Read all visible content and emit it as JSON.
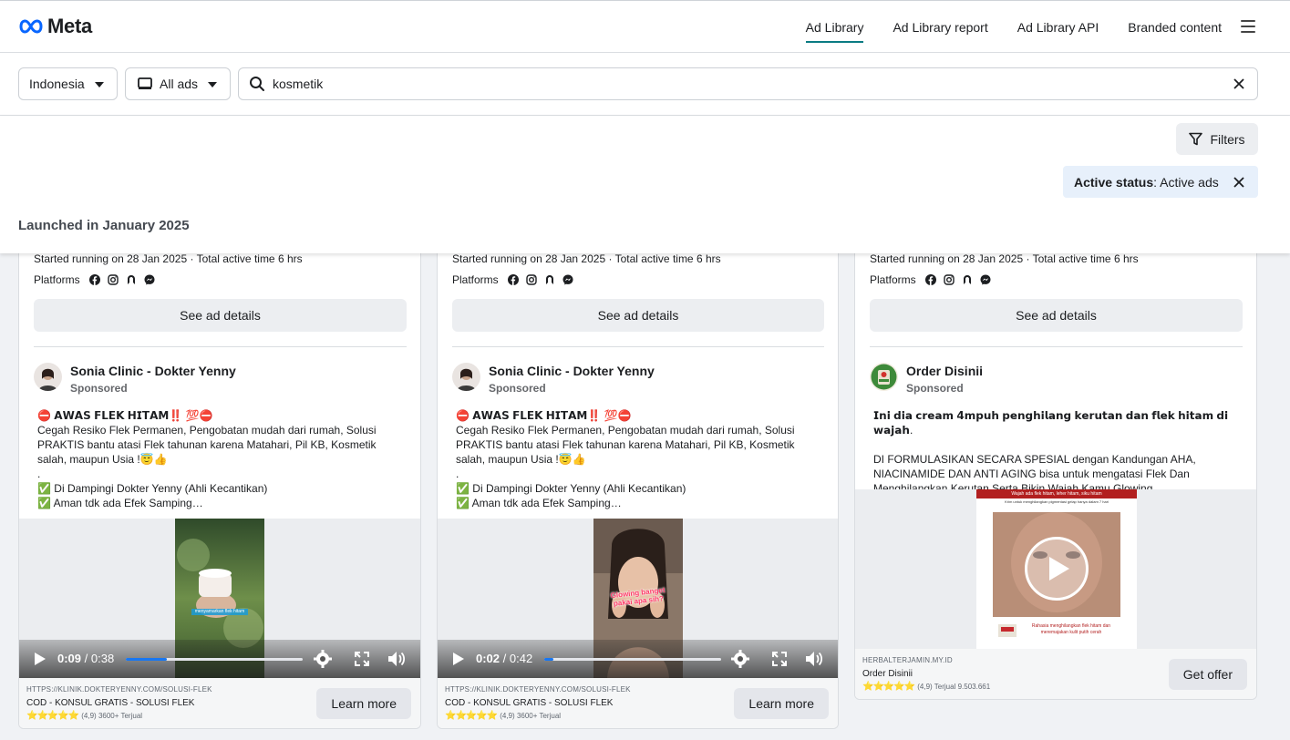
{
  "nav": {
    "logo": "Meta",
    "links": [
      "Ad Library",
      "Ad Library report",
      "Ad Library API",
      "Branded content"
    ],
    "menu_icon": "hamburger-icon"
  },
  "search": {
    "country": "Indonesia",
    "ad_type": "All ads",
    "query": "kosmetik"
  },
  "filters": {
    "button_label": "Filters",
    "active_status_key": "Active status",
    "active_status_value": ": Active ads"
  },
  "section_title": "Launched in January 2025",
  "cards": [
    {
      "started": "Started running on 28 Jan 2025 · Total active time 6 hrs",
      "platforms_label": "Platforms",
      "see_details": "See ad details",
      "advertiser": "Sonia Clinic - Dokter Yenny",
      "sponsored": "Sponsored",
      "text": [
        "⛔ 𝗔𝗪𝗔𝗦 𝗙𝗟𝗘𝗞 𝗛𝗜𝗧𝗔𝗠‼️ 💯⛔",
        "Cegah Resiko Flek Permanen, Pengobatan mudah dari rumah, Solusi PRAKTIS bantu atasi Flek tahunan karena Matahari, Pil KB, Kosmetik salah, maupun Usia !😇👍",
        ".",
        "✅ Di Dampingi Dokter Yenny (Ahli Kecantikan)",
        "✅ Aman tdk ada Efek Samping…"
      ],
      "video_time": "0:09",
      "video_duration": " / 0:38",
      "progress": 0.23,
      "thumb_caption": "menyamarkan flek hitam",
      "cta_url": "HTTPS://KLINIK.DOKTERYENNY.COM/SOLUSI-FLEK",
      "cta_title": "COD - KONSUL GRATIS - SOLUSI FLEK",
      "cta_stars": "⭐⭐⭐⭐⭐",
      "cta_rating": "(4,9) 3600+ Terjual",
      "cta_button": "Learn more"
    },
    {
      "started": "Started running on 28 Jan 2025 · Total active time 6 hrs",
      "platforms_label": "Platforms",
      "see_details": "See ad details",
      "advertiser": "Sonia Clinic - Dokter Yenny",
      "sponsored": "Sponsored",
      "text": [
        "⛔ 𝗔𝗪𝗔𝗦 𝗙𝗟𝗘𝗞 𝗛𝗜𝗧𝗔𝗠‼️ 💯⛔",
        "Cegah Resiko Flek Permanen, Pengobatan mudah dari rumah, Solusi PRAKTIS bantu atasi Flek tahunan karena Matahari, Pil KB, Kosmetik salah, maupun Usia !😇👍",
        ".",
        "✅ Di Dampingi Dokter Yenny (Ahli Kecantikan)",
        "✅ Aman tdk ada Efek Samping…"
      ],
      "video_time": "0:02",
      "video_duration": " / 0:42",
      "progress": 0.05,
      "thumb_caption": "Glowing banget pakai apa sih?",
      "cta_url": "HTTPS://KLINIK.DOKTERYENNY.COM/SOLUSI-FLEK",
      "cta_title": "COD - KONSUL GRATIS - SOLUSI FLEK",
      "cta_stars": "⭐⭐⭐⭐⭐",
      "cta_rating": "(4,9) 3600+ Terjual",
      "cta_button": "Learn more"
    },
    {
      "started": "Started running on 28 Jan 2025 · Total active time 6 hrs",
      "platforms_label": "Platforms",
      "see_details": "See ad details",
      "advertiser": "Order Disinii",
      "sponsored": "Sponsored",
      "text": [
        "𝗜𝗻𝗶 𝗱𝗶𝗮 𝗰𝗿𝗲𝗮𝗺 𝟰𝗺𝗽𝘂𝗵 𝗽𝗲𝗻𝗴𝗵𝗶𝗹𝗮𝗻𝗴 𝗸𝗲𝗿𝘂𝘁𝗮𝗻 𝗱𝗮𝗻 𝗳𝗹𝗲𝗸 𝗵𝗶𝘁𝗮𝗺 𝗱𝗶 𝘄𝗮𝗷𝗮𝗵.",
        "",
        "DI FORMULASIKAN SECARA SPESIAL dengan Kandungan AHA, NIACINAMIDE DAN ANTI AGING bisa untuk mengatasi Flek Dan Menghilangkan Kerutan Serta Bikin Wajah Kamu Glowing"
      ],
      "thumb_top": "Wajah ada flek hitam, leher hitam, siku hitam",
      "thumb_sub": "Krim untuk menghilangkan pigmentasi gelap hanya dalam 7 hari",
      "thumb_bottom": "Rahasia menghilangkan flek hitam dan meremajakan kulit putih cerah",
      "cta_url": "HERBALTERJAMIN.MY.ID",
      "cta_title": "Order Disinii",
      "cta_stars": "⭐⭐⭐⭐⭐",
      "cta_rating": "(4,9) Terjual 9.503.661",
      "cta_button": "Get offer"
    }
  ]
}
